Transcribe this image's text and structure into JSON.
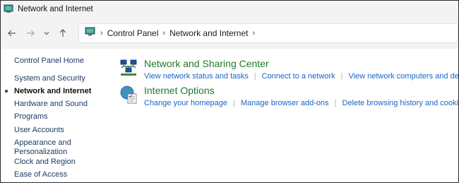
{
  "window": {
    "title": "Network and Internet"
  },
  "nav": {
    "back_icon": "arrow-left-icon",
    "forward_icon": "arrow-right-icon",
    "recent_icon": "chevron-down-icon",
    "up_icon": "arrow-up-icon"
  },
  "address": {
    "crumbs": [
      "Control Panel",
      "Network and Internet"
    ]
  },
  "sidebar": {
    "home": "Control Panel Home",
    "items": [
      {
        "label": "System and Security"
      },
      {
        "label": "Network and Internet",
        "active": true
      },
      {
        "label": "Hardware and Sound"
      },
      {
        "label": "Programs"
      },
      {
        "label": "User Accounts"
      },
      {
        "label": "Appearance and"
      },
      {
        "label": "Personalization"
      },
      {
        "label": "Clock and Region"
      },
      {
        "label": "Ease of Access"
      }
    ]
  },
  "categories": [
    {
      "title": "Network and Sharing Center",
      "icon": "network-sharing-icon",
      "links": [
        "View network status and tasks",
        "Connect to a network",
        "View network computers and devices"
      ]
    },
    {
      "title": "Internet Options",
      "icon": "internet-options-icon",
      "links": [
        "Change your homepage",
        "Manage browser add-ons",
        "Delete browsing history and cookies"
      ]
    }
  ],
  "colors": {
    "category_title": "#1e7a2a",
    "link": "#1a64c8",
    "sidebar_link": "#1e3c64"
  }
}
